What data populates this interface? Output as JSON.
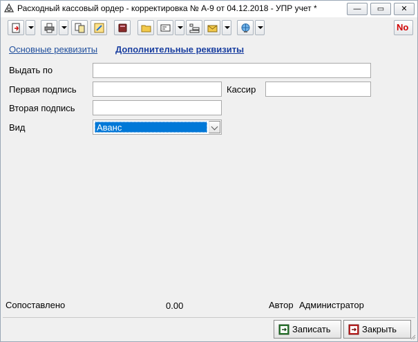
{
  "window": {
    "title": "Расходный кассовый ордер - корректировка № А-9 от 04.12.2018 - УПР учет *",
    "minimize_glyph": "—",
    "maximize_glyph": "▭",
    "close_glyph": "✕"
  },
  "toolbar": {
    "buttons": [
      "new-doc-icon",
      "print-icon",
      "copy-icon",
      "edit-icon",
      "book-icon",
      "folder-icon",
      "card-icon",
      "list-icon",
      "envelope-icon",
      "globe-icon",
      "number-icon"
    ],
    "number_label": "No"
  },
  "tabs": {
    "main": "Основные реквизиты",
    "extra": "Дополнительные реквизиты"
  },
  "form": {
    "issue_to_label": "Выдать по",
    "issue_to_value": "",
    "first_sign_label": "Первая подпись",
    "first_sign_value": "",
    "cashier_label": "Кассир",
    "cashier_value": "",
    "second_sign_label": "Вторая подпись",
    "second_sign_value": "",
    "kind_label": "Вид",
    "kind_value": "Аванс"
  },
  "footer": {
    "matched_label": "Сопоставлено",
    "matched_value": "0.00",
    "author_label": "Автор",
    "author_value": "Администратор",
    "save_label": "Записать",
    "close_label": "Закрыть"
  }
}
